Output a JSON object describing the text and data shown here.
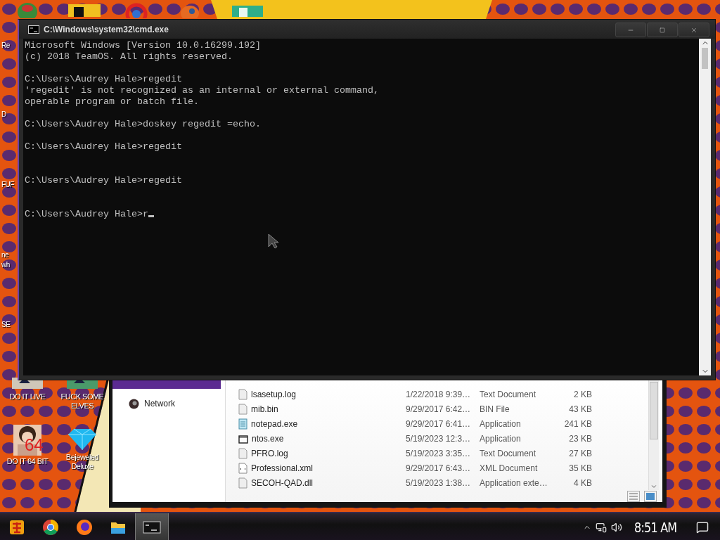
{
  "top_icons": [
    {
      "kind": "green-ball"
    },
    {
      "kind": "yellow-tile"
    },
    {
      "kind": "ring"
    },
    {
      "kind": "bird"
    },
    {
      "kind": "p-tile"
    }
  ],
  "cut_labels": [
    {
      "lines": [
        "Re"
      ]
    },
    {
      "lines": [
        "D"
      ]
    },
    {
      "lines": [
        "FUF"
      ]
    },
    {
      "lines": [
        "ne",
        "wh"
      ]
    },
    {
      "lines": [
        "SE"
      ]
    }
  ],
  "desktop_icons": [
    {
      "label": "DO IT LIVE"
    },
    {
      "label": "FUCK SOME ELVES",
      "kind": "game"
    },
    {
      "label": "DO IT 64 BIT",
      "kind": "portrait",
      "badge": "64"
    },
    {
      "label": "Bejeweled Deluxe",
      "kind": "gem"
    }
  ],
  "explorer": {
    "nav_items": [
      {
        "label": "Network",
        "selected": false
      }
    ],
    "files": [
      {
        "name": "lsasetup.log",
        "modified": "1/22/2018 9:39…",
        "type": "Text Document",
        "size": "2 KB",
        "kind": "doc"
      },
      {
        "name": "mib.bin",
        "modified": "9/29/2017 6:42…",
        "type": "BIN File",
        "size": "43 KB",
        "kind": "doc"
      },
      {
        "name": "notepad.exe",
        "modified": "9/29/2017 6:41…",
        "type": "Application",
        "size": "241 KB",
        "kind": "notepad"
      },
      {
        "name": "ntos.exe",
        "modified": "5/19/2023 12:3…",
        "type": "Application",
        "size": "23 KB",
        "kind": "app"
      },
      {
        "name": "PFRO.log",
        "modified": "5/19/2023 3:35…",
        "type": "Text Document",
        "size": "27 KB",
        "kind": "doc"
      },
      {
        "name": "Professional.xml",
        "modified": "9/29/2017 6:43…",
        "type": "XML Document",
        "size": "35 KB",
        "kind": "xml"
      },
      {
        "name": "SECOH-QAD.dll",
        "modified": "5/19/2023 1:38…",
        "type": "Application exte…",
        "size": "4 KB",
        "kind": "doc"
      }
    ]
  },
  "cmd": {
    "title": "C:\\Windows\\system32\\cmd.exe",
    "cursor_visible": true,
    "blocks": [
      {
        "kind": "output",
        "lines": [
          "Microsoft Windows [Version 10.0.16299.192]",
          "(c) 2018 TeamOS. All rights reserved."
        ]
      },
      {
        "kind": "output",
        "lines": [
          "C:\\Users\\Audrey Hale>regedit",
          "'regedit' is not recognized as an internal or external command,",
          "operable program or batch file."
        ]
      },
      {
        "kind": "output",
        "lines": [
          "C:\\Users\\Audrey Hale>doskey regedit =echo."
        ]
      },
      {
        "kind": "echo",
        "lines": [
          "C:\\Users\\Audrey Hale>regedit"
        ]
      },
      {
        "kind": "echo",
        "lines": [
          "C:\\Users\\Audrey Hale>regedit"
        ]
      },
      {
        "kind": "prompt",
        "lines": [
          "C:\\Users\\Audrey Hale>r"
        ]
      }
    ]
  },
  "taskbar": {
    "buttons": [
      {
        "kind": "start",
        "selected": false
      },
      {
        "kind": "chrome",
        "selected": false
      },
      {
        "kind": "firefox",
        "selected": false
      },
      {
        "kind": "folder",
        "selected": false
      },
      {
        "kind": "cmd",
        "selected": true
      }
    ],
    "clock": "8:51 AM"
  }
}
